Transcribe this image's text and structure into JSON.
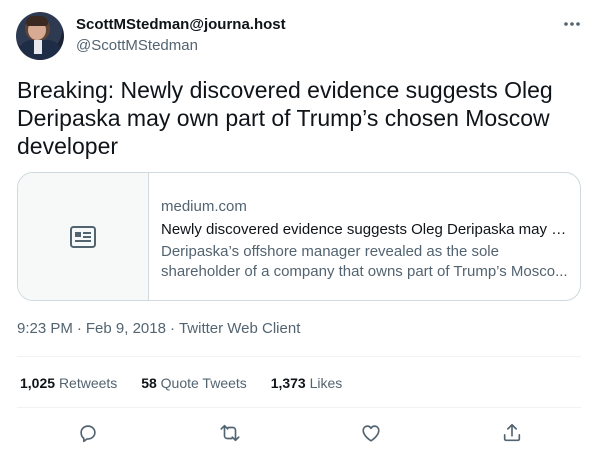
{
  "author": {
    "display_name": "ScottMStedman@journa.host",
    "handle": "@ScottMStedman"
  },
  "more_icon": "more-horizontal-icon",
  "tweet_text": "Breaking: Newly discovered evidence suggests Oleg Deripaska may own part of Trump’s chosen Moscow developer",
  "card": {
    "domain": "medium.com",
    "title": "Newly discovered evidence suggests Oleg Deripaska may o...",
    "description": "Deripaska’s offshore manager revealed as the sole shareholder of a company that owns part of Trump’s Mosco...",
    "thumb_icon": "article-icon"
  },
  "meta": {
    "time": "9:23 PM",
    "date": "Feb 9, 2018",
    "client": "Twitter Web Client",
    "separator": "·"
  },
  "stats": {
    "retweets_count": "1,025",
    "retweets_label": "Retweets",
    "quotes_count": "58",
    "quotes_label": "Quote Tweets",
    "likes_count": "1,373",
    "likes_label": "Likes"
  },
  "actions": [
    "reply-icon",
    "retweet-icon",
    "like-icon",
    "share-icon"
  ],
  "colors": {
    "text_primary": "#0f1419",
    "text_secondary": "#536471",
    "border": "#cfd9de",
    "divider": "#eff3f4"
  }
}
